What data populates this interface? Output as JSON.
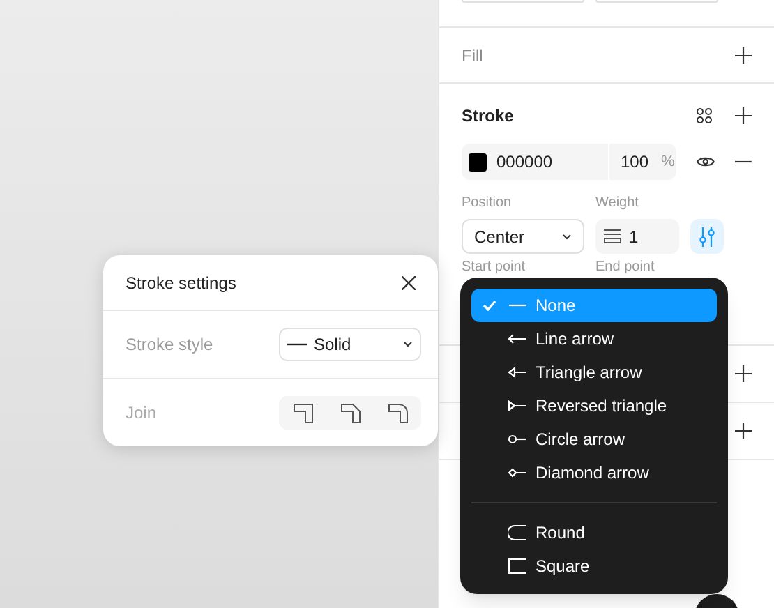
{
  "panel": {
    "fill": {
      "label": "Fill"
    },
    "stroke": {
      "label": "Stroke",
      "color_hex": "000000",
      "color": "#000000",
      "opacity": "100",
      "opacity_unit": "%",
      "position_label": "Position",
      "position_value": "Center",
      "weight_label": "Weight",
      "weight_value": "1",
      "start_label": "Start point",
      "end_label": "End point"
    }
  },
  "stroke_settings": {
    "title": "Stroke settings",
    "style_label": "Stroke style",
    "style_value": "Solid",
    "join_label": "Join"
  },
  "endpoint_menu": {
    "items": [
      {
        "kind": "none",
        "label": "None",
        "selected": true
      },
      {
        "kind": "line",
        "label": "Line arrow",
        "selected": false
      },
      {
        "kind": "triangle",
        "label": "Triangle arrow",
        "selected": false
      },
      {
        "kind": "reversed",
        "label": "Reversed triangle",
        "selected": false
      },
      {
        "kind": "circle",
        "label": "Circle arrow",
        "selected": false
      },
      {
        "kind": "diamond",
        "label": "Diamond arrow",
        "selected": false
      }
    ],
    "caps": [
      {
        "kind": "round",
        "label": "Round",
        "selected": false
      },
      {
        "kind": "square",
        "label": "Square",
        "selected": false
      }
    ]
  }
}
